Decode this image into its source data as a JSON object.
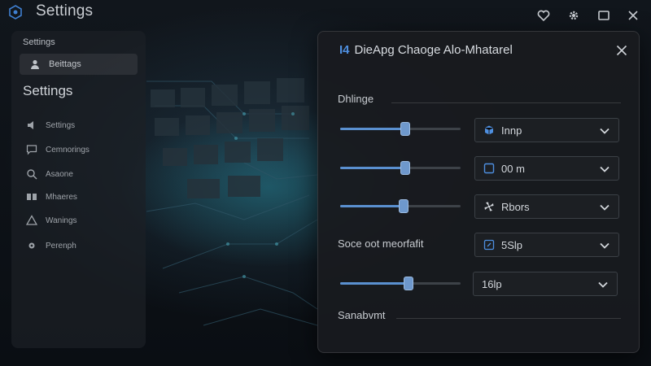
{
  "window": {
    "title": "Settings"
  },
  "sidebar": {
    "heading": "Settings",
    "active_item": "Beittags",
    "title": "Settings",
    "items": [
      {
        "label": "Settings",
        "icon": "speaker-icon"
      },
      {
        "label": "Cemnorings",
        "icon": "chat-icon"
      },
      {
        "label": "Asaone",
        "icon": "search-icon"
      },
      {
        "label": "Mhaeres",
        "icon": "grid-icon"
      },
      {
        "label": "Wanings",
        "icon": "warning-icon"
      },
      {
        "label": "Perenph",
        "icon": "gear-icon"
      }
    ]
  },
  "dialog": {
    "title_prefix": "I4",
    "title": "DieApg Chaoge Alo-Mhatarel",
    "section1": "Dhlinge",
    "rows": [
      {
        "slider_value": 0.54,
        "dropdown_value": "Innp",
        "dropdown_icon": "cube-icon"
      },
      {
        "slider_value": 0.54,
        "dropdown_value": "00 m",
        "dropdown_icon": "square-icon"
      },
      {
        "slider_value": 0.53,
        "dropdown_value": "Rbors",
        "dropdown_icon": "fan-icon"
      },
      {
        "label": "Soce oot meorfafit",
        "dropdown_value": "5Slp",
        "dropdown_icon": "panel-icon"
      },
      {
        "slider_value": 0.57,
        "dropdown_value": "16lp"
      }
    ],
    "section2": "Sanabvmt"
  },
  "colors": {
    "accent": "#5a90d0",
    "dialog_bg": "#181b1f",
    "sidebar_bg": "#1c2025"
  }
}
